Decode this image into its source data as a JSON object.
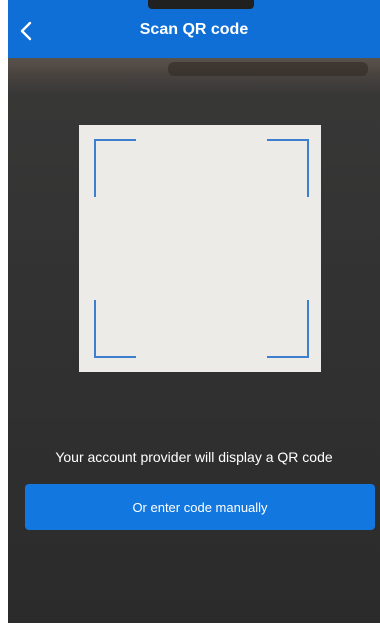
{
  "header": {
    "title": "Scan QR code",
    "back_icon": "chevron-left-icon"
  },
  "scanner": {
    "instruction": "Your account provider will display a QR code"
  },
  "actions": {
    "manual_entry_label": "Or enter code manually"
  },
  "colors": {
    "header_bg": "#0f6fd6",
    "button_bg": "#1377e0",
    "frame_corners": "#3d7fcf",
    "camera_bg": "#333333"
  }
}
